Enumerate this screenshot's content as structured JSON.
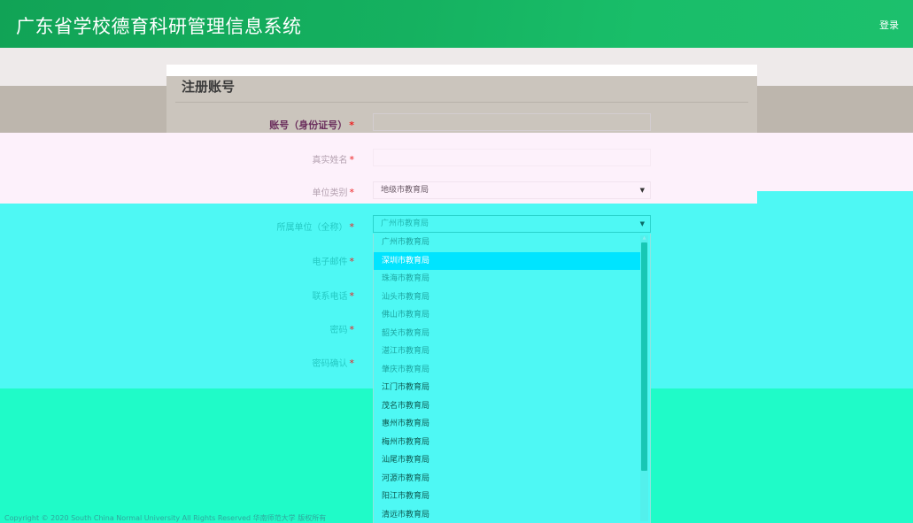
{
  "header": {
    "title": "广东省学校德育科研管理信息系统",
    "login_label": "登录"
  },
  "card": {
    "title": "注册账号"
  },
  "form": {
    "account_label": "账号（身份证号）",
    "real_name_label": "真实姓名",
    "unit_type_label": "单位类别",
    "unit_type_value": "地级市教育局",
    "unit_name_label": "所属单位（全称）",
    "unit_name_value": "广州市教育局",
    "email_label": "电子邮件",
    "phone_label": "联系电话",
    "password_label": "密码",
    "password_confirm_label": "密码确认",
    "required_mark": "*"
  },
  "dropdown": {
    "options": [
      "广州市教育局",
      "深圳市教育局",
      "珠海市教育局",
      "汕头市教育局",
      "佛山市教育局",
      "韶关市教育局",
      "湛江市教育局",
      "肇庆市教育局",
      "江门市教育局",
      "茂名市教育局",
      "惠州市教育局",
      "梅州市教育局",
      "汕尾市教育局",
      "河源市教育局",
      "阳江市教育局",
      "清远市教育局"
    ],
    "selected_index": 1
  },
  "footer": {
    "copyright": "Copyright © 2020 South China Normal University All Rights Reserved 华南师范大学 版权所有"
  },
  "colors": {
    "header_green": "#15b160",
    "required_red": "#ee2222",
    "selected_option": "#00e4ff"
  }
}
